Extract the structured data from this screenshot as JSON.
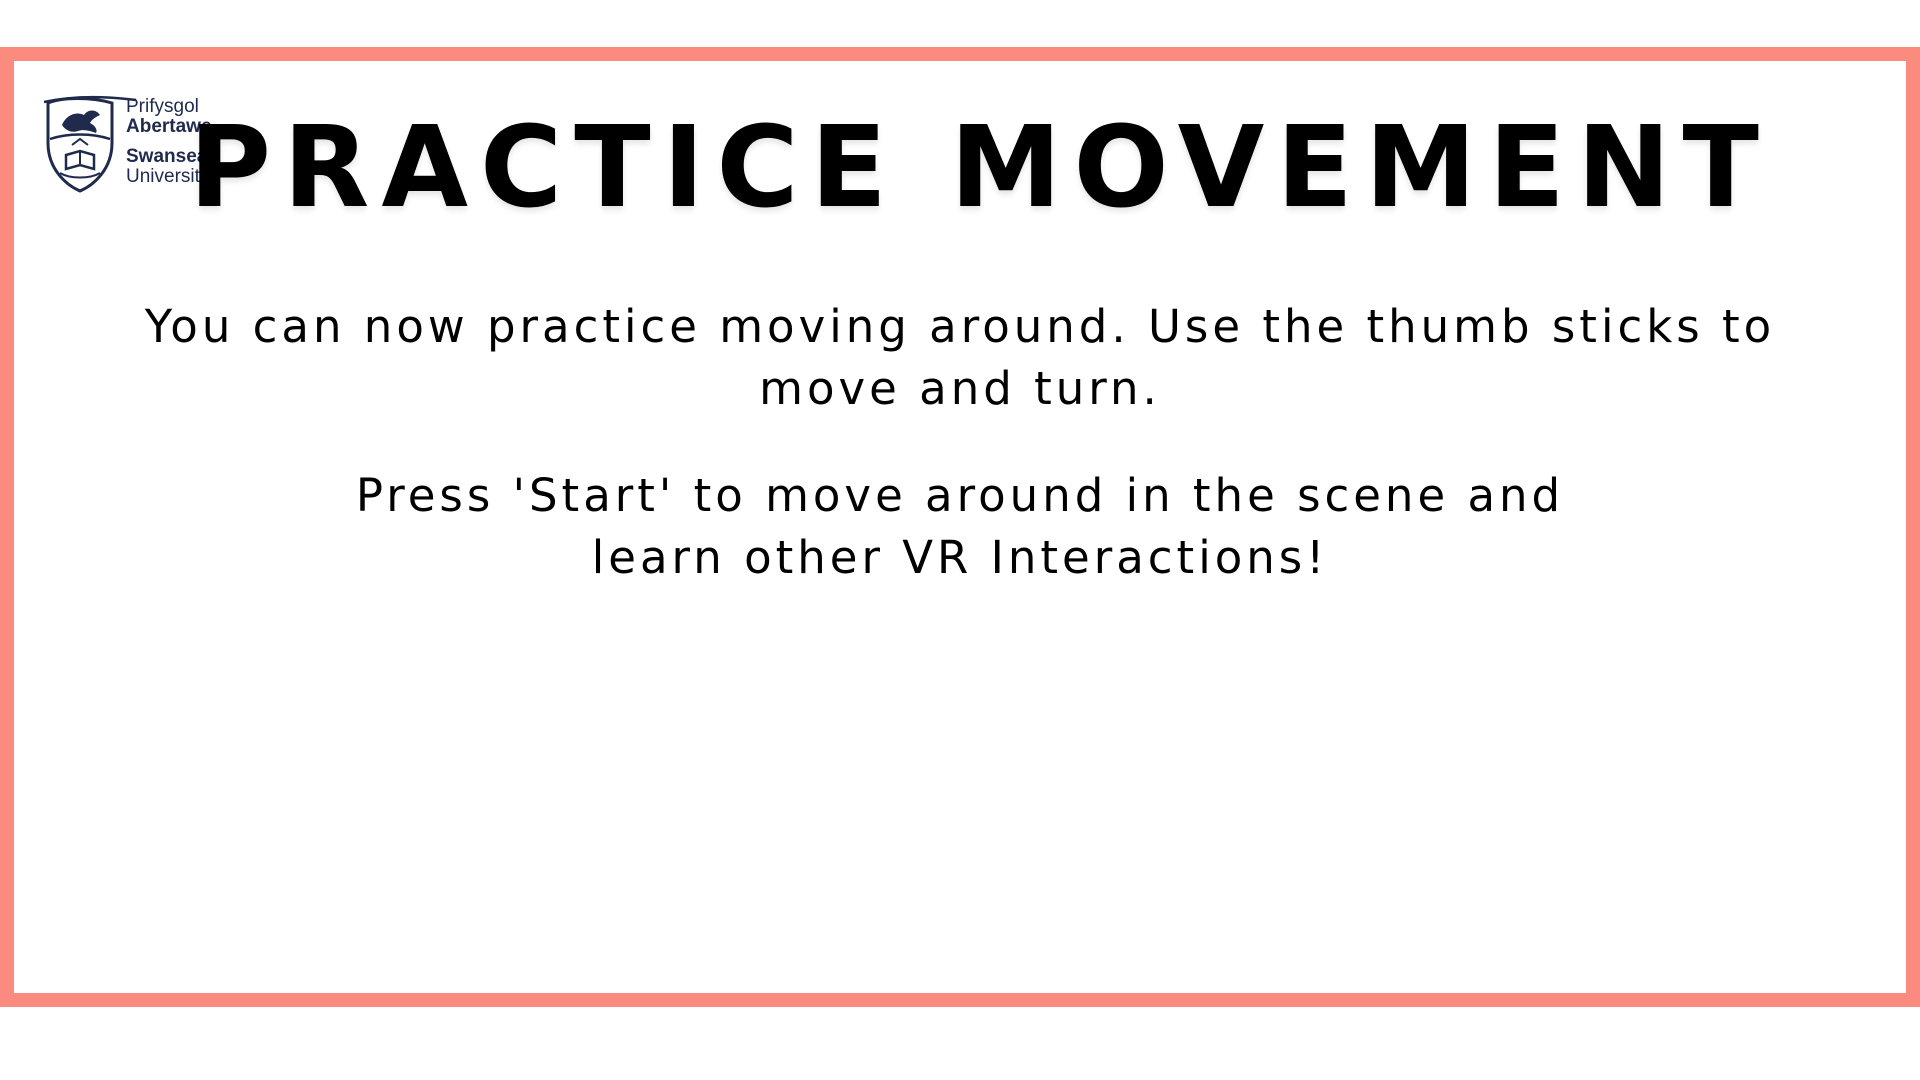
{
  "logo": {
    "line1": "Prifysgol",
    "line2": "Abertawe",
    "line3": "Swansea",
    "line4": "University",
    "icon": "crest-icon",
    "color": "#1f2a4d"
  },
  "frame": {
    "border_color": "#fb8b7f"
  },
  "title": "PRACTICE MOVEMENT",
  "instructions": {
    "line1": "You can now practice moving around. Use the thumb sticks to",
    "line2": "move and turn."
  },
  "next_step": {
    "line1": "Press 'Start' to move around in the scene and",
    "line2": "learn other VR Interactions!"
  }
}
